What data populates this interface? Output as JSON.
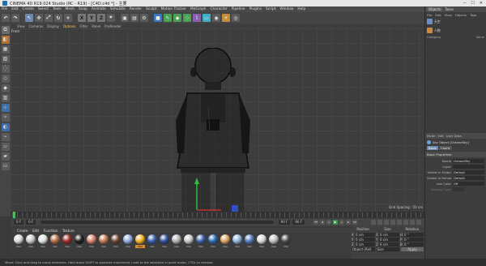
{
  "window": {
    "title": "CINEMA 4D R19.024 Studio (RC - R19) - [C4D.c4d *] - 主要"
  },
  "menu": {
    "items": [
      "File",
      "Edit",
      "Create",
      "Select",
      "Tools",
      "Mesh",
      "Snap",
      "Animate",
      "Simulate",
      "Render",
      "Sculpt",
      "Motion Tracker",
      "MoGraph",
      "Character",
      "Pipeline",
      "Plugins",
      "Script",
      "Window",
      "Help"
    ],
    "layout_label": "Layout:",
    "layout_value": "Startup"
  },
  "toolbar": {
    "axis_labels": [
      "X",
      "Y",
      "Z"
    ]
  },
  "viewport": {
    "menu": [
      "View",
      "Cameras",
      "Display",
      "Options",
      "Filter",
      "Panel",
      "ProRender"
    ],
    "active_menu": "Options",
    "label": "Front",
    "grid_spacing": "Grid Spacing : 50 cm"
  },
  "timeline": {
    "start_frame": "0 F",
    "current_frame": "0 F",
    "end_frame": "90 F",
    "max_frame": "90 F"
  },
  "material_manager": {
    "menu": [
      "Create",
      "Edit",
      "Function",
      "Texture"
    ],
    "materials": [
      {
        "name": "Mat",
        "color": "#d8d8d8"
      },
      {
        "name": "Mat",
        "color": "#c8c8c8"
      },
      {
        "name": "Mat",
        "color": "#e0e0e0"
      },
      {
        "name": "Mat",
        "color": "#b06a40"
      },
      {
        "name": "Mat",
        "color": "#a02828"
      },
      {
        "name": "Mat",
        "color": "#1e1e1e"
      },
      {
        "name": "Mat",
        "color": "#d98070"
      },
      {
        "name": "Mat",
        "color": "#c07850"
      },
      {
        "name": "Mat",
        "color": "#6a4530"
      },
      {
        "name": "Mat",
        "color": "#8fa8d8"
      },
      {
        "name": "Mat",
        "color": "#f0b020",
        "selected": true
      },
      {
        "name": "Mat",
        "color": "#3a5fb0"
      },
      {
        "name": "Mat",
        "color": "#2f4f9a"
      },
      {
        "name": "Mat",
        "color": "#b0b0b0"
      },
      {
        "name": "Mat",
        "color": "#c8c8c8"
      },
      {
        "name": "Mat",
        "color": "#3e5ea8"
      },
      {
        "name": "Mat",
        "color": "#2a6ab8"
      },
      {
        "name": "Mat",
        "color": "#d8a060"
      },
      {
        "name": "Mat",
        "color": "#8fb0d8"
      },
      {
        "name": "Mat",
        "color": "#4f78c0"
      },
      {
        "name": "Mat",
        "color": "#d8d8d8"
      },
      {
        "name": "Mat",
        "color": "#c0c0c0"
      },
      {
        "name": "Mat",
        "color": "#4a4a4a"
      }
    ]
  },
  "coordinates": {
    "headers": [
      "Position",
      "Size",
      "Rotation"
    ],
    "rows": [
      {
        "axis": "X",
        "pos": "0 cm",
        "size": "0 cm",
        "rot_axis": "H",
        "rot": "0 °"
      },
      {
        "axis": "Y",
        "pos": "0 cm",
        "size": "0 cm",
        "rot_axis": "P",
        "rot": "0 °"
      },
      {
        "axis": "Z",
        "pos": "0 cm",
        "size": "0 cm",
        "rot_axis": "B",
        "rot": "0 °"
      }
    ],
    "mode": "Object (Rel)",
    "size_mode": "Size",
    "apply": "Apply"
  },
  "object_manager": {
    "tabs": [
      "Objects",
      "Takes"
    ],
    "active_tab": "Objects",
    "menu": [
      "File",
      "Edit",
      "View",
      "Objects",
      "Tags"
    ],
    "objects": [
      "天空",
      "人物"
    ],
    "columns": [
      "Category",
      "Value"
    ]
  },
  "attributes": {
    "menu": [
      "Mode",
      "Edit",
      "User Data"
    ],
    "object_title": "Sky Object [OctaneSky]",
    "tabs": [
      "Basic",
      "Coord."
    ],
    "active_tab": "Basic",
    "section": "Basic Properties",
    "props": [
      {
        "label": "Name",
        "value": "OctaneSky"
      },
      {
        "label": "Layer",
        "value": ""
      },
      {
        "label": "Visible in Editor",
        "value": "Default"
      },
      {
        "label": "Visible in Renderer",
        "value": "Default"
      },
      {
        "label": "Use Color",
        "value": "Off"
      },
      {
        "label": "Display Color",
        "value": "",
        "disabled": true
      }
    ]
  },
  "status": {
    "text": "Move: Click and drag to move elements. Hold down SHIFT to quantize movement / add to the selection in point mode, CTRL to remove."
  }
}
